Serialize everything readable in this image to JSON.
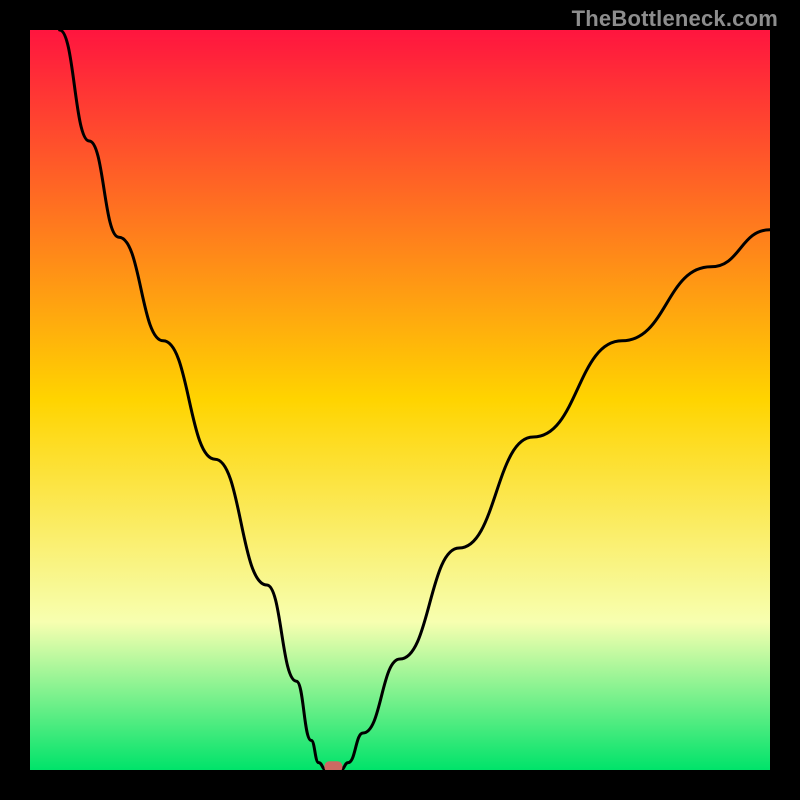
{
  "watermark": "TheBottleneck.com",
  "colors": {
    "frame": "#000000",
    "grad_top": "#ff153f",
    "grad_mid": "#ffd400",
    "grad_low": "#f7ffb0",
    "grad_bottom": "#00e36a",
    "curve": "#000000",
    "marker": "#cc6a62"
  },
  "chart_data": {
    "type": "line",
    "title": "",
    "xlabel": "",
    "ylabel": "",
    "xlim": [
      0,
      100
    ],
    "ylim": [
      0,
      100
    ],
    "annotations": [],
    "series": [
      {
        "name": "bottleneck-curve",
        "x": [
          4,
          8,
          12,
          18,
          25,
          32,
          36,
          38,
          39,
          40,
          42,
          43,
          45,
          50,
          58,
          68,
          80,
          92,
          100
        ],
        "y": [
          100,
          85,
          72,
          58,
          42,
          25,
          12,
          4,
          1,
          0,
          0,
          1,
          5,
          15,
          30,
          45,
          58,
          68,
          73
        ]
      }
    ],
    "marker": {
      "x": 41,
      "y": 0.5
    }
  }
}
